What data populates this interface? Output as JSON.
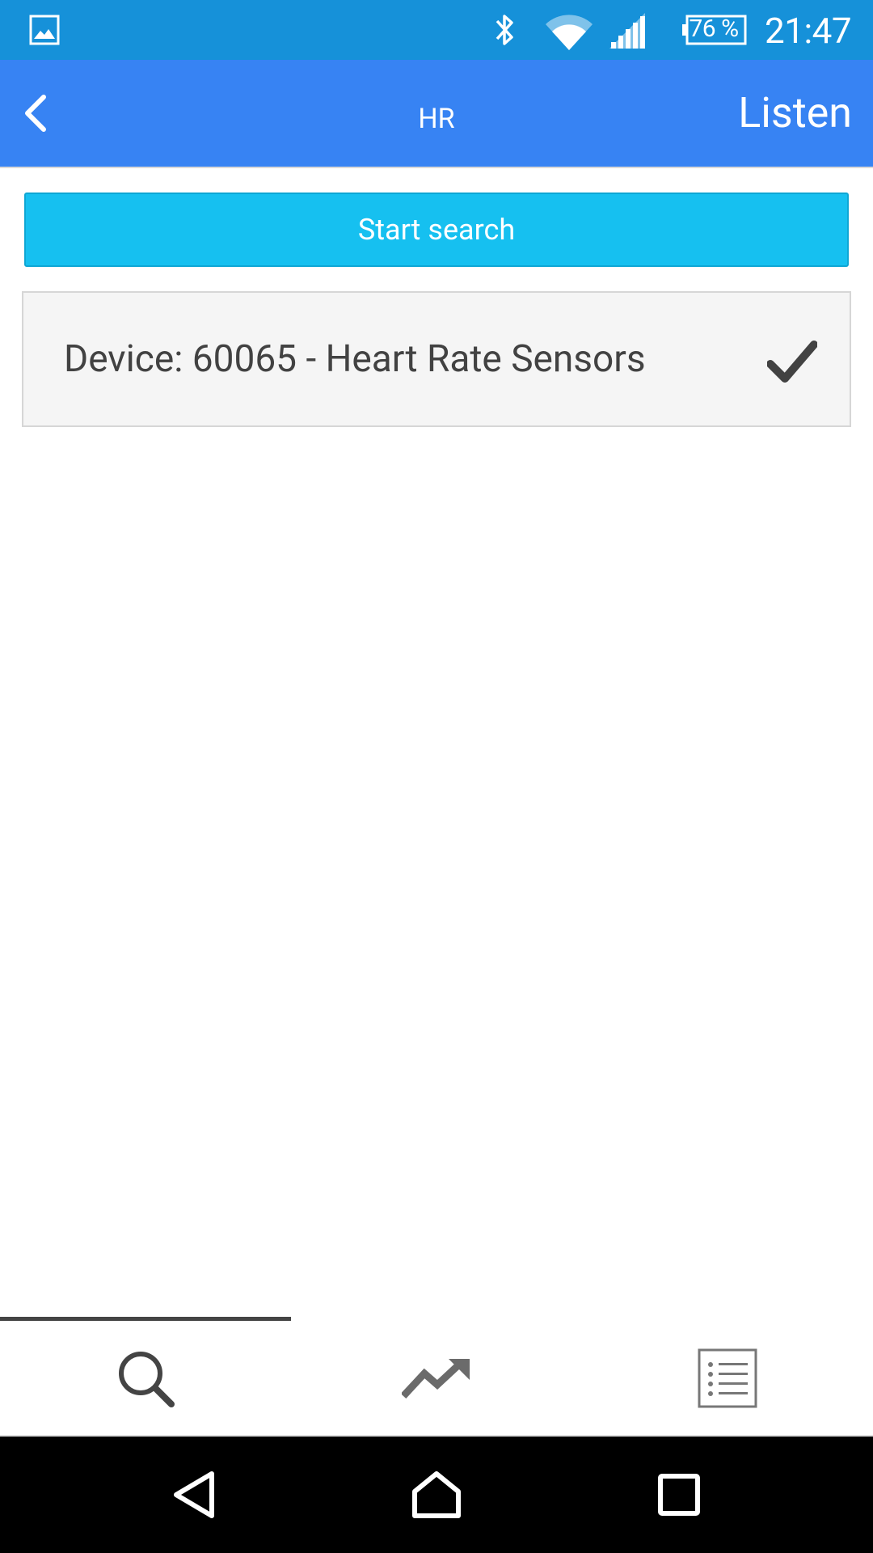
{
  "status_bar": {
    "battery_percent": "76 %",
    "time": "21:47",
    "icons": [
      "gallery-icon",
      "bluetooth-icon",
      "wifi-icon",
      "signal-icon",
      "battery-icon"
    ]
  },
  "app_bar": {
    "back_icon": "chevron-left-icon",
    "title": "HR",
    "action_label": "Listen"
  },
  "main": {
    "start_search_label": "Start search",
    "devices": [
      {
        "label": "Device: 60065 - Heart Rate Sensors",
        "selected": true,
        "icon": "checkmark-icon"
      }
    ]
  },
  "tabs": [
    {
      "icon": "search-icon",
      "active": true
    },
    {
      "icon": "trend-chart-icon",
      "active": false
    },
    {
      "icon": "list-icon",
      "active": false
    }
  ],
  "nav_bar": {
    "icons": [
      "nav-back-icon",
      "nav-home-icon",
      "nav-recent-apps-icon"
    ]
  },
  "colors": {
    "status_bar": "#1691d9",
    "app_bar": "#3783f3",
    "start_button": "#16c0f0",
    "device_row_bg": "#f5f5f5",
    "text_dark": "#424242"
  }
}
